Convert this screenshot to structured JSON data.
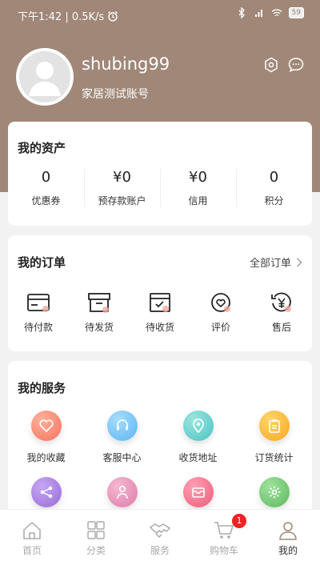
{
  "status_bar": {
    "time_speed": "下午1:42 | 0.5K/s",
    "battery": "59"
  },
  "profile": {
    "username": "shubing99",
    "subtitle": "家居测试账号"
  },
  "assets": {
    "title": "我的资产",
    "items": [
      {
        "value": "0",
        "label": "优惠券"
      },
      {
        "value": "¥0",
        "label": "预存款账户"
      },
      {
        "value": "¥0",
        "label": "信用"
      },
      {
        "value": "0",
        "label": "积分"
      }
    ]
  },
  "orders": {
    "title": "我的订单",
    "all_label": "全部订单",
    "items": [
      {
        "label": "待付款",
        "icon": "wallet-icon"
      },
      {
        "label": "待发货",
        "icon": "box-icon"
      },
      {
        "label": "待收货",
        "icon": "receive-icon"
      },
      {
        "label": "评价",
        "icon": "review-icon"
      },
      {
        "label": "售后",
        "icon": "after-sale-icon"
      }
    ]
  },
  "services": {
    "title": "我的服务",
    "items": [
      {
        "label": "我的收藏",
        "icon": "heart-icon",
        "color": "#f7715f"
      },
      {
        "label": "客服中心",
        "icon": "headset-icon",
        "color": "#5bb5f0"
      },
      {
        "label": "收货地址",
        "icon": "location-icon",
        "color": "#4cc2c2"
      },
      {
        "label": "订货统计",
        "icon": "clipboard-icon",
        "color": "#f7a821"
      },
      {
        "label": "",
        "icon": "share-icon",
        "color": "#9a6bd8"
      },
      {
        "label": "",
        "icon": "person-icon",
        "color": "#e07aa8"
      },
      {
        "label": "",
        "icon": "mail-icon",
        "color": "#ef5a7a"
      },
      {
        "label": "",
        "icon": "gear-icon",
        "color": "#5cb85c"
      }
    ]
  },
  "tabbar": {
    "items": [
      {
        "label": "首页",
        "icon": "home-icon"
      },
      {
        "label": "分类",
        "icon": "grid-icon"
      },
      {
        "label": "服务",
        "icon": "handshake-icon"
      },
      {
        "label": "购物车",
        "icon": "cart-icon",
        "badge": "1"
      },
      {
        "label": "我的",
        "icon": "user-icon",
        "active": true
      }
    ]
  },
  "colors": {
    "header": "#a08777",
    "badge": "#e22222"
  }
}
